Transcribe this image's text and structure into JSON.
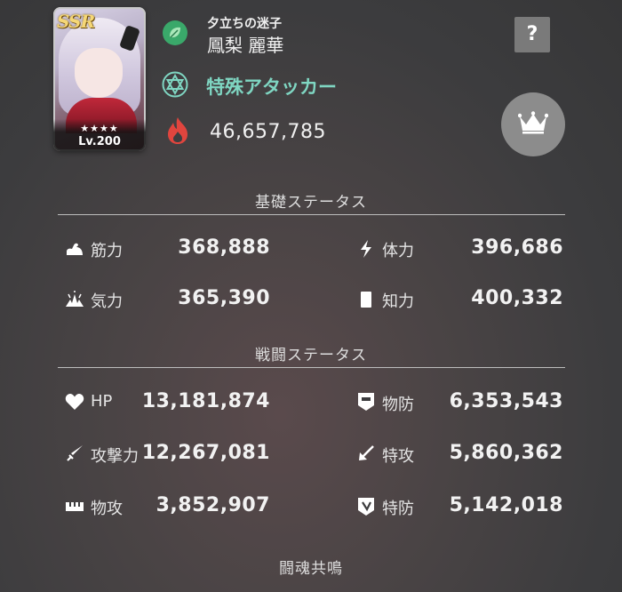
{
  "card": {
    "rarity": "SSR",
    "stars": "★★★★",
    "level": "Lv.200"
  },
  "header": {
    "subtitle": "夕立ちの迷子",
    "name": "鳳梨 麗華",
    "role": "特殊アタッカー",
    "power": "46,657,785",
    "help_label": "?"
  },
  "icons": {
    "element": "leaf-element-icon",
    "role": "hexagram-icon",
    "power": "flame-icon",
    "crown": "crown-icon"
  },
  "colors": {
    "role_accent": "#7fd6c2",
    "flame": "#e0453e",
    "element": "#3aa86a"
  },
  "basic_status": {
    "title": "基礎ステータス",
    "stats": [
      {
        "label": "筋力",
        "value": "368,888",
        "icon": "muscle-icon"
      },
      {
        "label": "体力",
        "value": "396,686",
        "icon": "lightning-icon"
      },
      {
        "label": "気力",
        "value": "365,390",
        "icon": "spirit-icon"
      },
      {
        "label": "知力",
        "value": "400,332",
        "icon": "book-icon"
      }
    ]
  },
  "battle_status": {
    "title": "戦闘ステータス",
    "stats": [
      {
        "label": "HP",
        "value": "13,181,874",
        "icon": "heart-icon"
      },
      {
        "label": "物防",
        "value": "6,353,543",
        "icon": "physical-defense-icon"
      },
      {
        "label": "攻撃力",
        "value": "12,267,081",
        "icon": "sword-icon"
      },
      {
        "label": "特攻",
        "value": "5,860,362",
        "icon": "special-attack-icon"
      },
      {
        "label": "物攻",
        "value": "3,852,907",
        "icon": "physical-attack-icon"
      },
      {
        "label": "特防",
        "value": "5,142,018",
        "icon": "special-defense-icon"
      }
    ]
  },
  "footer": {
    "label": "闘魂共鳴"
  }
}
